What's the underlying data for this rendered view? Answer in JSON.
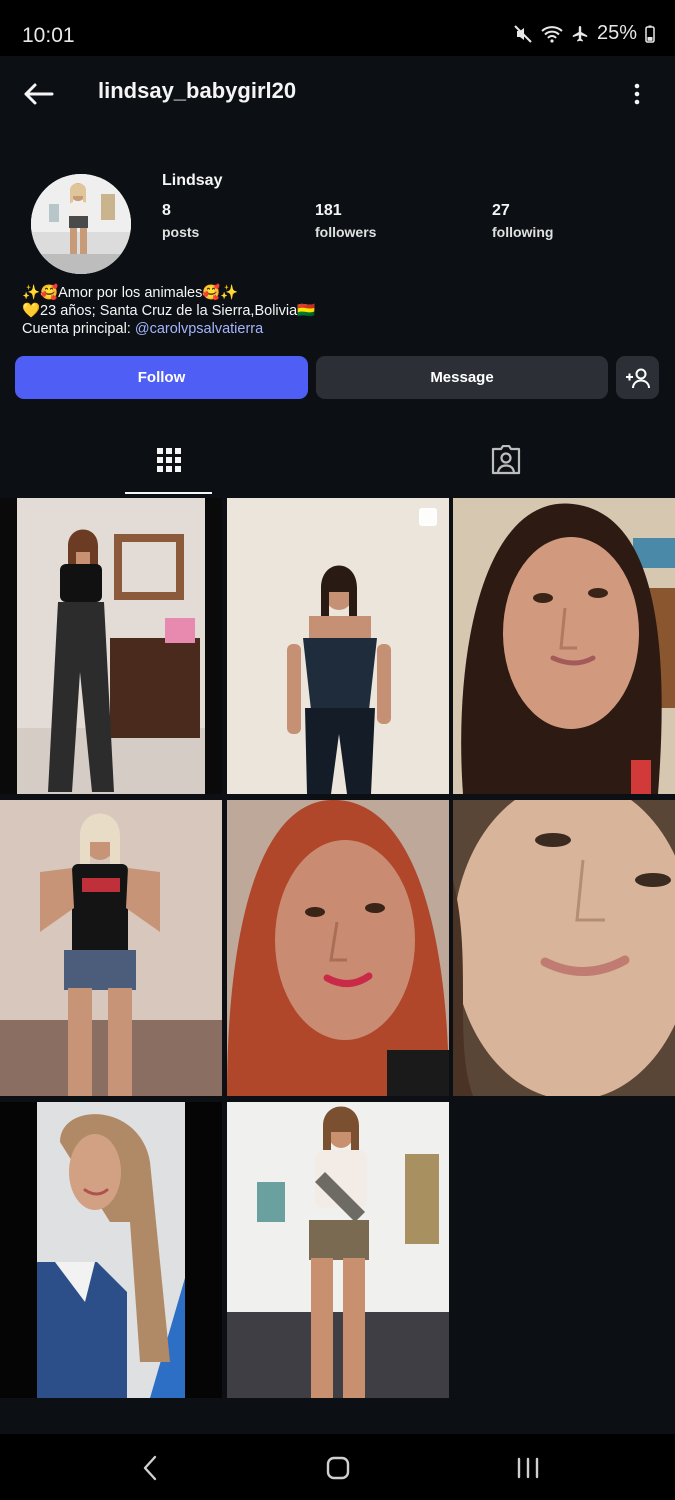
{
  "status_bar": {
    "time": "10:01",
    "battery": "25%"
  },
  "profile": {
    "username": "lindsay_babygirl20",
    "display_name": "Lindsay",
    "posts_count": "8",
    "posts_label": "posts",
    "followers_count": "181",
    "followers_label": "followers",
    "following_count": "27",
    "following_label": "following",
    "bio_line1": "✨🥰Amor por los animales🥰✨",
    "bio_line2": "💛23 años; Santa Cruz de la Sierra,Bolivia🇧🇴",
    "bio_line3_prefix": "Cuenta principal: ",
    "bio_link": "@carolvpsalvatierra"
  },
  "actions": {
    "follow": "Follow",
    "message": "Message"
  },
  "colors": {
    "accent": "#4f5ff6",
    "link": "#a5b4fc",
    "background": "#0c1014",
    "secondary_button": "#2c3036"
  },
  "icons": [
    "back-arrow-icon",
    "more-vertical-icon",
    "add-person-icon",
    "grid-icon",
    "tagged-photos-icon",
    "multi-photo-icon",
    "nav-back-icon",
    "nav-home-icon",
    "nav-recents-icon"
  ],
  "posts": [
    {
      "name": "post-1"
    },
    {
      "name": "post-2",
      "multi": true
    },
    {
      "name": "post-3"
    },
    {
      "name": "post-4"
    },
    {
      "name": "post-5"
    },
    {
      "name": "post-6"
    },
    {
      "name": "post-7"
    },
    {
      "name": "post-8"
    }
  ]
}
